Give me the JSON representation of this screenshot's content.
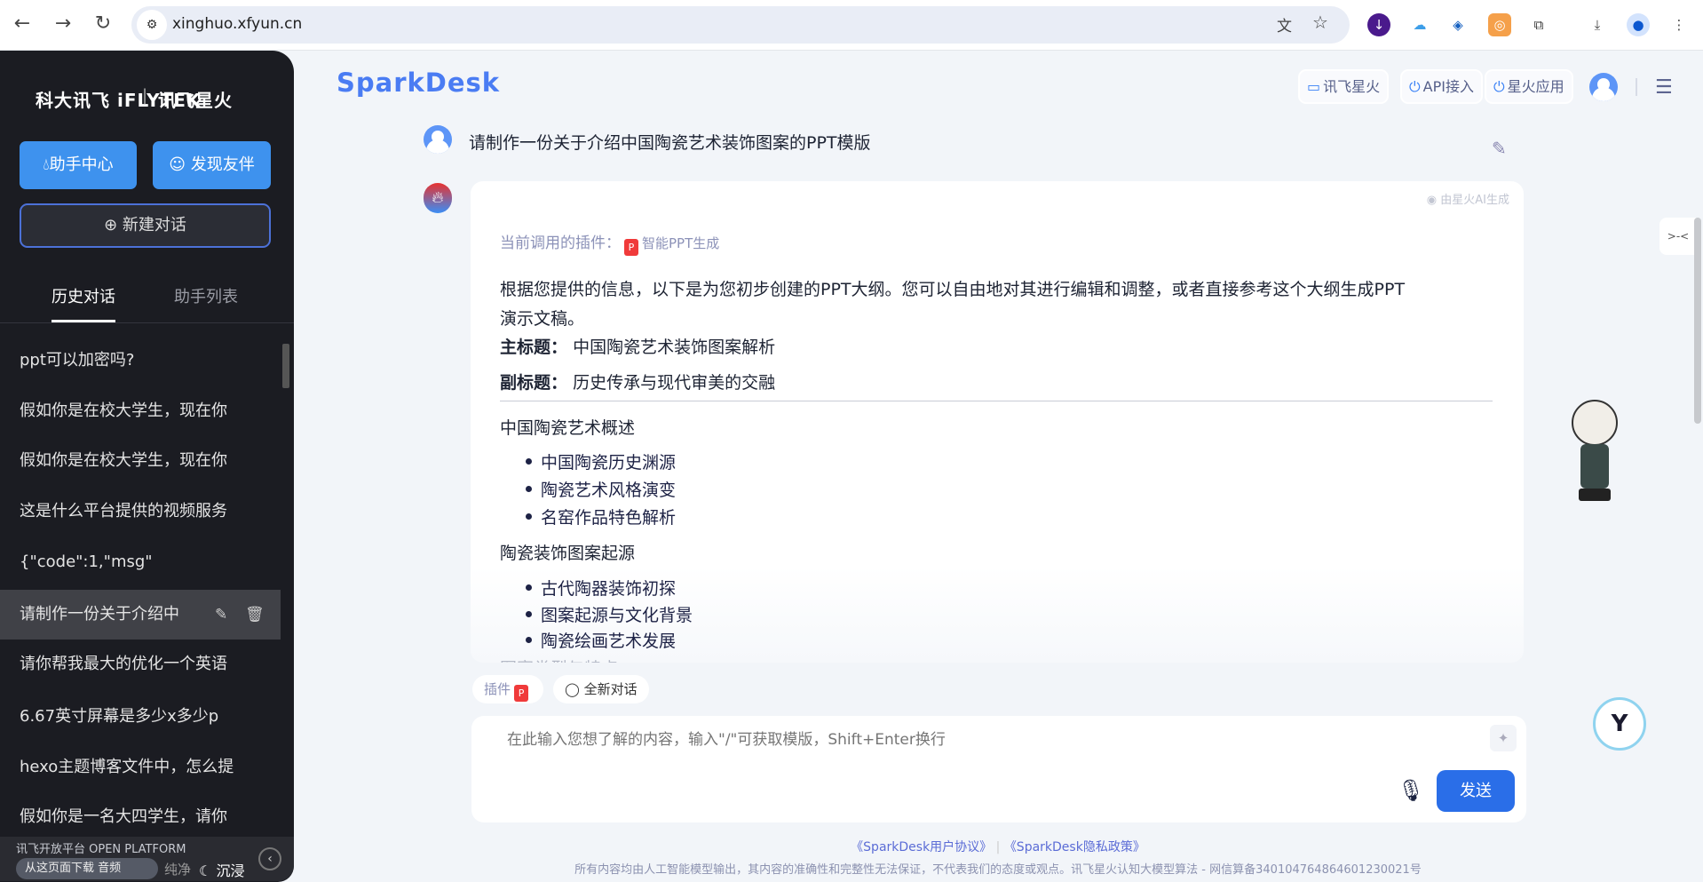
{
  "browser": {
    "url": "xinghuo.xfyun.cn"
  },
  "sidebar": {
    "logo_left": "科大讯飞 iFLYTEK",
    "logo_right": "讯飞星火",
    "assistant_center": "助手中心",
    "discover_partners": "发现友伴",
    "new_chat": "新建对话",
    "tabs": [
      {
        "label": "历史对话",
        "active": true
      },
      {
        "label": "助手列表",
        "active": false
      }
    ],
    "history": [
      "ppt可以加密吗?",
      "假如你是在校大学生，现在你",
      "假如你是在校大学生，现在你",
      "这是什么平台提供的视频服务",
      "{\"code\":1,\"msg\"",
      "请制作一份关于介绍中",
      "请你帮我最大的优化一个英语",
      "6.67英寸屏幕是多少x多少p",
      "hexo主题博客文件中，怎么提",
      "假如你是一名大四学生，请你"
    ],
    "selected_index": 5,
    "footer": {
      "overlay_text": "讯飞开放平台 OPEN PLATFORM",
      "download_audio": "从这页面下载 音频",
      "pure": "纯净",
      "immersive": "沉浸"
    }
  },
  "header": {
    "brand": "SparkDesk",
    "buttons": [
      "讯飞星火",
      "API接入",
      "星火应用"
    ]
  },
  "chat": {
    "user_message": "请制作一份关于介绍中国陶瓷艺术装饰图案的PPT模版",
    "ai_badge": "由星火AI生成",
    "plugin_label": "当前调用的插件：",
    "plugin_name": "智能PPT生成",
    "intro_line1": "根据您提供的信息，以下是为您初步创建的PPT大纲。您可以自由地对其进行编辑和调整，或者直接参考这个大纲生成PPT",
    "intro_line2": "演示文稿。",
    "main_title_label": "主标题：",
    "main_title": "中国陶瓷艺术装饰图案解析",
    "sub_title_label": "副标题：",
    "sub_title": "历史传承与现代审美的交融",
    "sections": [
      {
        "title": "中国陶瓷艺术概述",
        "items": [
          "中国陶瓷历史渊源",
          "陶瓷艺术风格演变",
          "名窑作品特色解析"
        ]
      },
      {
        "title": "陶瓷装饰图案起源",
        "items": [
          "古代陶器装饰初探",
          "图案起源与文化背景",
          "陶瓷绘画艺术发展"
        ]
      },
      {
        "title": "图案类型与特点",
        "items": []
      }
    ]
  },
  "chips": {
    "plugin": "插件",
    "new_chat": "全新对话"
  },
  "input": {
    "placeholder": "在此输入您想了解的内容，输入\"/\"可获取模版，Shift+Enter换行",
    "value": "",
    "send": "发送"
  },
  "footer": {
    "user_agreement": "《SparkDesk用户协议》",
    "privacy": "《SparkDesk隐私政策》",
    "separator": "|",
    "disclaimer": "所有内容均由人工智能模型输出，其内容的准确性和完整性无法保证，不代表我们的态度或观点。讯飞星火认知大模型算法 - 网信算备340104764864601230021号"
  },
  "colors": {
    "accent": "#2a6ee8",
    "sidebar_bg": "#1b1c22",
    "sidebar_button": "#3e92ee",
    "page_bg": "#f2f5f9"
  }
}
